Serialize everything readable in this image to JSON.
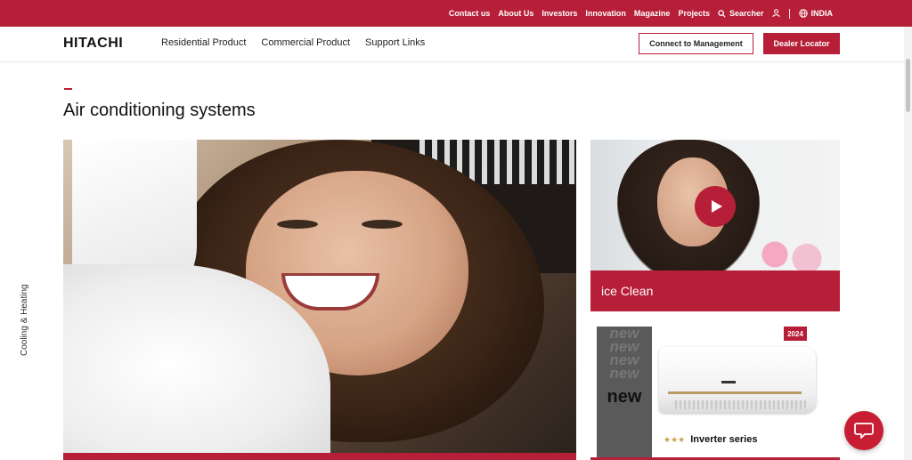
{
  "topbar": {
    "links": [
      "Contact us",
      "About Us",
      "Investors",
      "Innovation",
      "Magazine",
      "Projects"
    ],
    "search_label": "Searcher",
    "region_label": "INDIA"
  },
  "nav": {
    "logo": "HITACHI",
    "menu": [
      "Residential Product",
      "Commercial Product",
      "Support Links"
    ],
    "connect_button": "Connect to Management",
    "dealer_button": "Dealer Locator"
  },
  "main": {
    "title": "Air conditioning systems",
    "side_label": "Cooling & Heating",
    "card_video": {
      "label": "ice Clean"
    },
    "card_product": {
      "badge": "2024",
      "new_word": "new",
      "series_label": "Inverter series",
      "stars": "★★★"
    }
  },
  "colors": {
    "brand": "#b61f37",
    "chat": "#c81e33",
    "star": "#c9a24a"
  },
  "icons": [
    "search-icon",
    "user-icon",
    "globe-icon",
    "play-icon",
    "chat-icon"
  ]
}
